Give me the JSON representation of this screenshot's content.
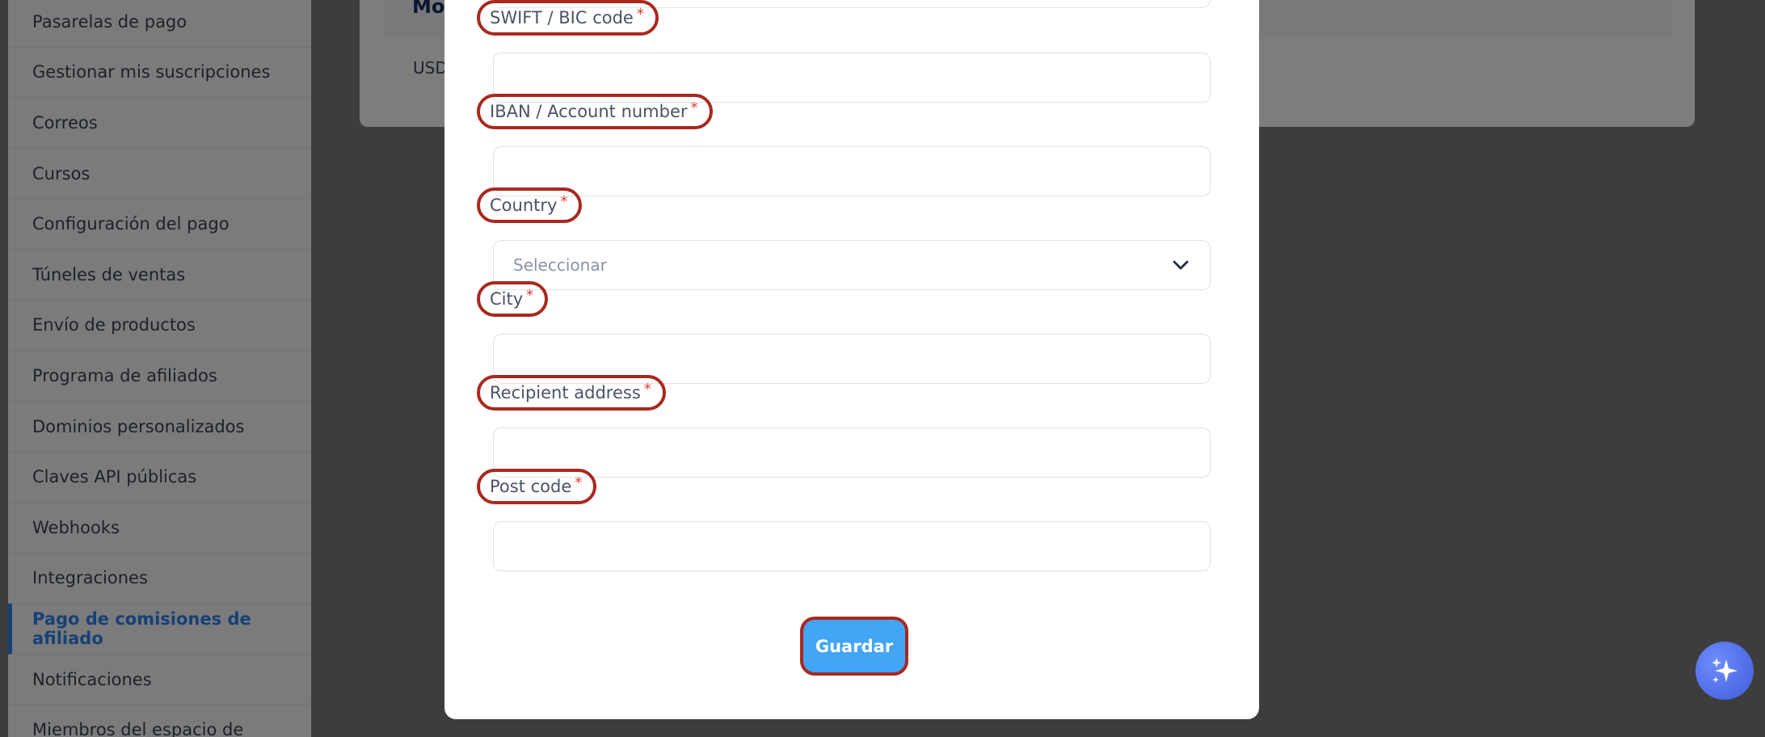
{
  "sidebar": {
    "items": [
      {
        "label": "Pasarelas de pago",
        "active": false
      },
      {
        "label": "Gestionar mis suscripciones",
        "active": false
      },
      {
        "label": "Correos",
        "active": false
      },
      {
        "label": "Cursos",
        "active": false
      },
      {
        "label": "Configuración del pago",
        "active": false
      },
      {
        "label": "Túneles de ventas",
        "active": false
      },
      {
        "label": "Envío de productos",
        "active": false
      },
      {
        "label": "Programa de afiliados",
        "active": false
      },
      {
        "label": "Dominios personalizados",
        "active": false
      },
      {
        "label": "Claves API públicas",
        "active": false
      },
      {
        "label": "Webhooks",
        "active": false
      },
      {
        "label": "Integraciones",
        "active": false
      },
      {
        "label": "Pago de comisiones de afiliado",
        "active": true
      },
      {
        "label": "Notificaciones",
        "active": false
      },
      {
        "label": "Miembros del espacio de",
        "active": false
      }
    ]
  },
  "content": {
    "title": "Mo",
    "cell": "USD"
  },
  "modal": {
    "fields": [
      {
        "label": "SWIFT / BIC code",
        "value": ""
      },
      {
        "label": "IBAN / Account number",
        "value": ""
      },
      {
        "label": "Country",
        "placeholder": "Seleccionar"
      },
      {
        "label": "City",
        "value": ""
      },
      {
        "label": "Recipient address",
        "value": ""
      },
      {
        "label": "Post code",
        "value": ""
      }
    ],
    "required_mark": "*",
    "save_label": "Guardar"
  },
  "colors": {
    "accent": "#2f80ed",
    "button": "#42a5f5",
    "highlight": "#a8291f",
    "required": "#e53935"
  }
}
